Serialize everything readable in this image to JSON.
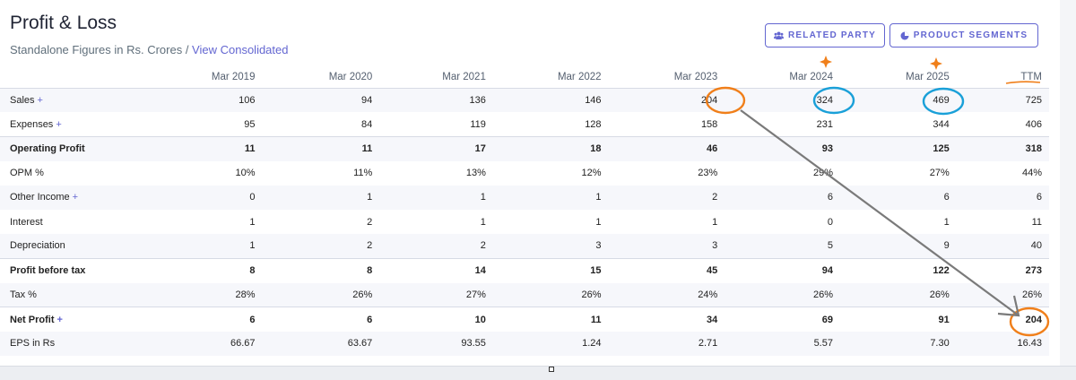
{
  "header": {
    "title": "Profit & Loss",
    "subtitle_text": "Standalone Figures in Rs. Crores / ",
    "subtitle_link": "View Consolidated"
  },
  "buttons": {
    "related_party": "RELATED PARTY",
    "product_segments": "PRODUCT SEGMENTS"
  },
  "icons": {
    "related_party": "users-icon",
    "product_segments": "pie-chart-icon"
  },
  "table": {
    "columns": [
      "Mar 2019",
      "Mar 2020",
      "Mar 2021",
      "Mar 2022",
      "Mar 2023",
      "Mar 2024",
      "Mar 2025",
      "TTM"
    ],
    "rows": [
      {
        "label": "Sales",
        "plus": "+",
        "values": [
          "106",
          "94",
          "136",
          "146",
          "204",
          "324",
          "469",
          "725"
        ]
      },
      {
        "label": "Expenses",
        "plus": "+",
        "values": [
          "95",
          "84",
          "119",
          "128",
          "158",
          "231",
          "344",
          "406"
        ]
      },
      {
        "label": "Operating Profit",
        "plus": "",
        "values": [
          "11",
          "11",
          "17",
          "18",
          "46",
          "93",
          "125",
          "318"
        ]
      },
      {
        "label": "OPM %",
        "plus": "",
        "values": [
          "10%",
          "11%",
          "13%",
          "12%",
          "23%",
          "29%",
          "27%",
          "44%"
        ]
      },
      {
        "label": "Other Income",
        "plus": "+",
        "values": [
          "0",
          "1",
          "1",
          "1",
          "2",
          "6",
          "6",
          "6"
        ]
      },
      {
        "label": "Interest",
        "plus": "",
        "values": [
          "1",
          "2",
          "1",
          "1",
          "1",
          "0",
          "1",
          "11"
        ]
      },
      {
        "label": "Depreciation",
        "plus": "",
        "values": [
          "1",
          "2",
          "2",
          "3",
          "3",
          "5",
          "9",
          "40"
        ]
      },
      {
        "label": "Profit before tax",
        "plus": "",
        "values": [
          "8",
          "8",
          "14",
          "15",
          "45",
          "94",
          "122",
          "273"
        ]
      },
      {
        "label": "Tax %",
        "plus": "",
        "values": [
          "28%",
          "26%",
          "27%",
          "26%",
          "24%",
          "26%",
          "26%",
          "26%"
        ]
      },
      {
        "label": "Net Profit",
        "plus": "+",
        "values": [
          "6",
          "6",
          "10",
          "11",
          "34",
          "69",
          "91",
          "204"
        ]
      },
      {
        "label": "EPS in Rs",
        "plus": "",
        "values": [
          "66.67",
          "63.67",
          "93.55",
          "1.24",
          "2.71",
          "5.57",
          "7.30",
          "16.43"
        ]
      }
    ]
  },
  "annotation_colors": {
    "orange": "#f07f1a",
    "blue": "#1aa0d8",
    "arrow": "#7a7a7a"
  }
}
